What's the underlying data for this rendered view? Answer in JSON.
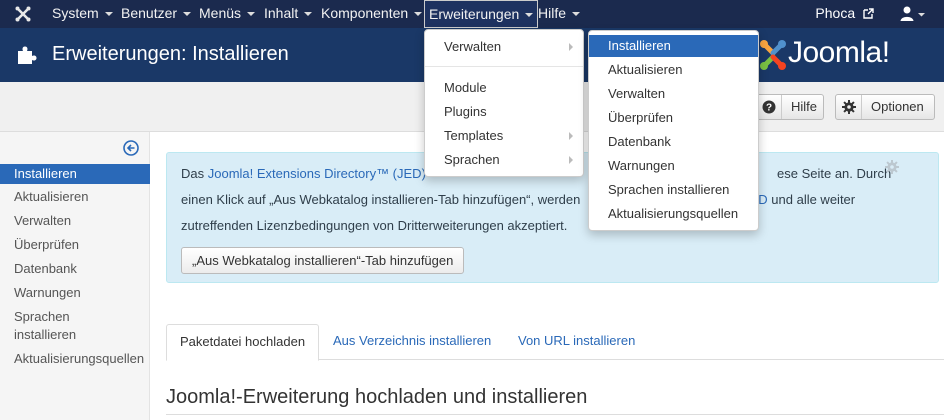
{
  "navbar": {
    "logo_icon": "joomla-icon",
    "menu": [
      {
        "label": "System"
      },
      {
        "label": "Benutzer"
      },
      {
        "label": "Menüs"
      },
      {
        "label": "Inhalt"
      },
      {
        "label": "Komponenten"
      },
      {
        "label": "Erweiterungen"
      },
      {
        "label": "Hilfe"
      }
    ],
    "user_link": "Phoca",
    "profile_icon": "user-icon"
  },
  "header": {
    "title": "Erweiterungen: Installieren",
    "brand": "Joomla!"
  },
  "toolbar": {
    "help_label": "Hilfe",
    "options_label": "Optionen"
  },
  "sidebar": {
    "items": [
      {
        "label": "Installieren"
      },
      {
        "label": "Aktualisieren"
      },
      {
        "label": "Verwalten"
      },
      {
        "label": "Überprüfen"
      },
      {
        "label": "Datenbank"
      },
      {
        "label": "Warnungen"
      },
      {
        "label": "Sprachen installieren"
      },
      {
        "label": "Aktualisierungsquellen"
      }
    ]
  },
  "notice": {
    "line1_a": "Das ",
    "line1_link": "Joomla! Extensions Directory™ (JED)",
    "line1_b": "ese Seite an. Durch",
    "line2_a": "einen Klick auf „Aus Webkatalog installieren-Tab hinzufügen“, werden",
    "line2_link": "s JED",
    "line2_b": " und alle weiter",
    "line3": "zutreffenden Lizenzbedingungen von Dritterweiterungen akzeptiert.",
    "button": "„Aus Webkatalog installieren“-Tab hinzufügen"
  },
  "tabs": [
    {
      "label": "Paketdatei hochladen"
    },
    {
      "label": "Aus Verzeichnis installieren"
    },
    {
      "label": "Von URL installieren"
    }
  ],
  "section_title": "Joomla!-Erweiterung hochladen und installieren",
  "dropdown_main": [
    {
      "label": "Verwalten"
    },
    {
      "label": "Module"
    },
    {
      "label": "Plugins"
    },
    {
      "label": "Templates"
    },
    {
      "label": "Sprachen"
    }
  ],
  "dropdown_sub": [
    {
      "label": "Installieren"
    },
    {
      "label": "Aktualisieren"
    },
    {
      "label": "Verwalten"
    },
    {
      "label": "Überprüfen"
    },
    {
      "label": "Datenbank"
    },
    {
      "label": "Warnungen"
    },
    {
      "label": "Sprachen installieren"
    },
    {
      "label": "Aktualisierungsquellen"
    }
  ],
  "colors": {
    "navbar": "#1b2a4e",
    "header": "#1a3867",
    "accent": "#2a69b8",
    "notice_bg": "#d9edf7"
  }
}
